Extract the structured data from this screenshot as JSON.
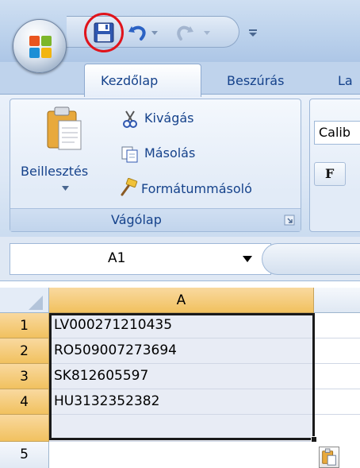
{
  "ribbon": {
    "tabs": [
      {
        "label": "Kezdőlap",
        "active": true
      },
      {
        "label": "Beszúrás",
        "active": false
      },
      {
        "label": "La",
        "active": false
      }
    ],
    "clipboard": {
      "paste_label": "Beillesztés",
      "cut_label": "Kivágás",
      "copy_label": "Másolás",
      "format_painter_label": "Formátummásoló",
      "group_label": "Vágólap"
    },
    "font": {
      "font_name": "Calib",
      "bold_label": "F"
    }
  },
  "formula_bar": {
    "name_box": "A1"
  },
  "sheet": {
    "column_headers": [
      "A"
    ],
    "rows": [
      {
        "num": "1",
        "a": "LV000271210435"
      },
      {
        "num": "2",
        "a": "RO509007273694"
      },
      {
        "num": "3",
        "a": "SK812605597"
      },
      {
        "num": "4",
        "a": "HU3132352382"
      },
      {
        "num": "5",
        "a": ""
      }
    ]
  },
  "colors": {
    "highlight_circle": "#e0141c",
    "selected_header": "#f1c15f",
    "ribbon_text": "#15428b"
  },
  "icons": [
    "office-logo-icon",
    "save-icon",
    "undo-icon",
    "redo-icon",
    "paste-icon",
    "scissors-icon",
    "copy-icon",
    "format-painter-icon",
    "paste-options-icon"
  ]
}
